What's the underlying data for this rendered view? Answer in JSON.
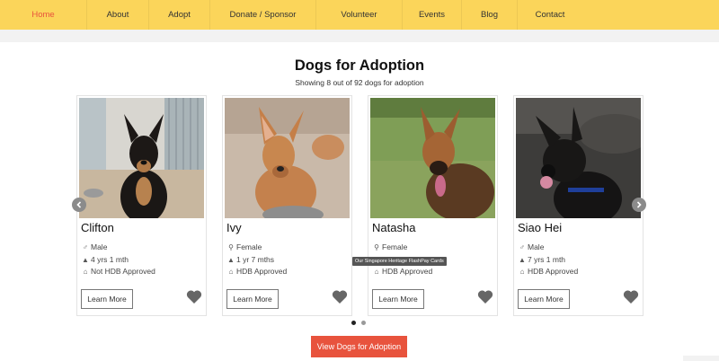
{
  "nav": {
    "items": [
      {
        "label": "Home",
        "active": true
      },
      {
        "label": "About"
      },
      {
        "label": "Adopt"
      },
      {
        "label": "Donate / Sponsor"
      },
      {
        "label": "Volunteer"
      },
      {
        "label": "Events"
      },
      {
        "label": "Blog"
      },
      {
        "label": "Contact"
      }
    ]
  },
  "section": {
    "title": "Dogs for Adoption",
    "subtitle": "Showing 8 out of 92 dogs for adoption"
  },
  "dogs": [
    {
      "name": "Clifton",
      "gender": "Male",
      "age": "4 yrs 1 mth",
      "hdb": "Not HDB Approved",
      "gender_icon": "male-icon"
    },
    {
      "name": "Ivy",
      "gender": "Female",
      "age": "1 yr 7 mths",
      "hdb": "HDB Approved",
      "gender_icon": "female-icon"
    },
    {
      "name": "Natasha",
      "gender": "Female",
      "age": "",
      "hdb": "HDB Approved",
      "gender_icon": "female-icon"
    },
    {
      "name": "Siao Hei",
      "gender": "Male",
      "age": "7 yrs 1 mth",
      "hdb": "HDB Approved",
      "gender_icon": "male-icon"
    }
  ],
  "card": {
    "learn_more_label": "Learn More"
  },
  "tooltip": "Our Singapore Heritage FlashPay Cards",
  "carousel": {
    "pages": 2,
    "current": 1
  },
  "cta": {
    "label": "View Dogs for Adoption"
  },
  "colors": {
    "nav_bg": "#fbd55a",
    "active": "#e8533d",
    "cta": "#e8533d",
    "heart": "#666666"
  }
}
